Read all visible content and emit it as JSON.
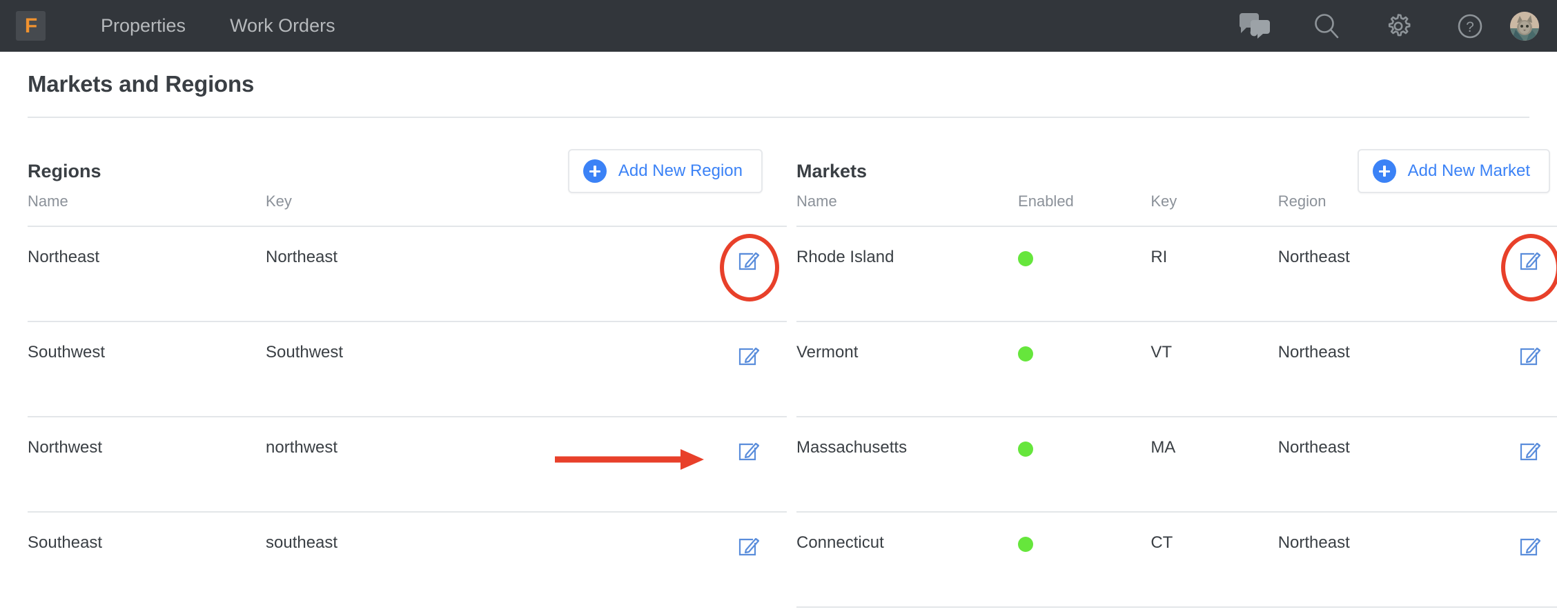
{
  "nav": {
    "logo_text": "F",
    "links": [
      {
        "label": "Properties"
      },
      {
        "label": "Work Orders"
      }
    ],
    "icons": [
      {
        "name": "chat-icon"
      },
      {
        "name": "search-icon"
      },
      {
        "name": "gear-icon"
      },
      {
        "name": "help-icon"
      },
      {
        "name": "avatar"
      }
    ],
    "bg_color": "#32363b",
    "logo_color": "#f0922f"
  },
  "page": {
    "title": "Markets and Regions"
  },
  "regions_panel": {
    "title": "Regions",
    "add_button": "Add New Region",
    "columns": [
      "Name",
      "Key"
    ],
    "rows": [
      {
        "name": "Northeast",
        "key": "Northeast",
        "highlighted": true
      },
      {
        "name": "Southwest",
        "key": "Southwest",
        "highlighted": false
      },
      {
        "name": "Northwest",
        "key": "northwest",
        "highlighted": false
      },
      {
        "name": "Southeast",
        "key": "southeast",
        "highlighted": false
      }
    ]
  },
  "markets_panel": {
    "title": "Markets",
    "add_button": "Add New Market",
    "columns": [
      "Name",
      "Enabled",
      "Key",
      "Region"
    ],
    "rows": [
      {
        "name": "Rhode Island",
        "enabled": true,
        "key": "RI",
        "region": "Northeast",
        "highlighted": true
      },
      {
        "name": "Vermont",
        "enabled": true,
        "key": "VT",
        "region": "Northeast",
        "highlighted": false
      },
      {
        "name": "Massachusetts",
        "enabled": true,
        "key": "MA",
        "region": "Northeast",
        "highlighted": false
      },
      {
        "name": "Connecticut",
        "enabled": true,
        "key": "CT",
        "region": "Northeast",
        "highlighted": false
      }
    ]
  },
  "annotations": {
    "arrow_color": "#e8402a",
    "circle_color": "#e8402a",
    "accent_blue": "#3b82f6",
    "enabled_green": "#66e63c"
  }
}
